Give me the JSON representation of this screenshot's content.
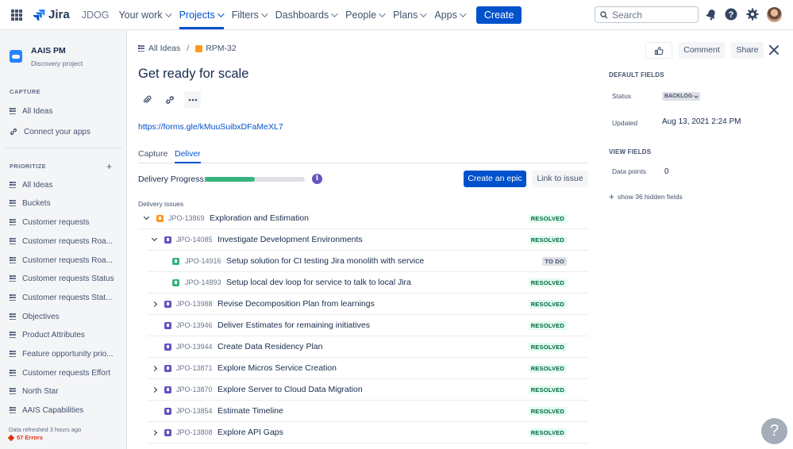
{
  "topnav": {
    "logo": "Jira",
    "instance": "JDOG",
    "items": [
      {
        "label": "Your work"
      },
      {
        "label": "Projects"
      },
      {
        "label": "Filters"
      },
      {
        "label": "Dashboards"
      },
      {
        "label": "People"
      },
      {
        "label": "Plans"
      },
      {
        "label": "Apps"
      }
    ],
    "create_label": "Create",
    "search_placeholder": "Search",
    "accent": "#0052cc"
  },
  "sidebar": {
    "project_name": "AAIS PM",
    "project_type": "Discovery project",
    "capture_label": "CAPTURE",
    "capture_items": [
      {
        "label": "All Ideas",
        "icon": "list-icon"
      },
      {
        "label": "Connect your apps",
        "icon": "link-icon"
      }
    ],
    "prioritize_label": "PRIORITIZE",
    "prioritize_items": [
      {
        "label": "All Ideas"
      },
      {
        "label": "Buckets"
      },
      {
        "label": "Customer requests"
      },
      {
        "label": "Customer requests Roa..."
      },
      {
        "label": "Customer requests Roa..."
      },
      {
        "label": "Customer requests Status"
      },
      {
        "label": "Customer requests Stat..."
      },
      {
        "label": "Objectives"
      },
      {
        "label": "Product Attributes"
      },
      {
        "label": "Feature opportunity prio..."
      },
      {
        "label": "Customer requests Effort"
      },
      {
        "label": "North Star"
      },
      {
        "label": "AAIS Capabilities"
      }
    ],
    "footer_refreshed": "Data refreshed 3 hours ago",
    "footer_errors": "57 Errors"
  },
  "issue": {
    "breadcrumb_root": "All Ideas",
    "breadcrumb_key": "RPM-32",
    "title": "Get ready for scale",
    "link": "https://forms.gle/kMuuSuibxDFaMeXL7",
    "tabs": [
      {
        "label": "Capture"
      },
      {
        "label": "Deliver"
      }
    ],
    "delivery_progress_label": "Delivery Progress:",
    "delivery_progress": 0.5,
    "create_epic_label": "Create an epic",
    "link_issue_label": "Link to issue",
    "delivery_issues_label": "Delivery issues",
    "rows": [
      {
        "level": 0,
        "caret": "down",
        "type": "idea",
        "key": "JPO-13869",
        "summary": "Exploration and Estimation",
        "status": "RESOLVED"
      },
      {
        "level": 1,
        "caret": "down",
        "type": "epic",
        "key": "JPO-14085",
        "summary": "Investigate Development Environments",
        "status": "RESOLVED"
      },
      {
        "level": 2,
        "caret": "",
        "type": "story",
        "key": "JPO-14916",
        "summary": "Setup solution for CI testing Jira monolith with service",
        "status": "TO DO"
      },
      {
        "level": 2,
        "caret": "",
        "type": "story",
        "key": "JPO-14893",
        "summary": "Setup local dev loop for service to talk to local Jira",
        "status": "RESOLVED"
      },
      {
        "level": 1,
        "caret": "right",
        "type": "epic",
        "key": "JPO-13988",
        "summary": "Revise Decomposition Plan from learnings",
        "status": "RESOLVED"
      },
      {
        "level": 1,
        "caret": "",
        "type": "epic",
        "key": "JPO-13946",
        "summary": "Deliver Estimates for remaining initiatives",
        "status": "RESOLVED"
      },
      {
        "level": 1,
        "caret": "",
        "type": "epic",
        "key": "JPO-13944",
        "summary": "Create Data Residency Plan",
        "status": "RESOLVED"
      },
      {
        "level": 1,
        "caret": "right",
        "type": "epic",
        "key": "JPO-13871",
        "summary": "Explore Micros Service Creation",
        "status": "RESOLVED"
      },
      {
        "level": 1,
        "caret": "right",
        "type": "epic",
        "key": "JPO-13870",
        "summary": "Explore Server to Cloud Data Migration",
        "status": "RESOLVED"
      },
      {
        "level": 1,
        "caret": "",
        "type": "epic",
        "key": "JPO-13854",
        "summary": "Estimate Timeline",
        "status": "RESOLVED"
      },
      {
        "level": 1,
        "caret": "right",
        "type": "epic",
        "key": "JPO-13808",
        "summary": "Explore API Gaps",
        "status": "RESOLVED"
      }
    ]
  },
  "panel": {
    "comment_label": "Comment",
    "share_label": "Share",
    "default_fields_label": "DEFAULT FIELDS",
    "status_label": "Status",
    "status_value": "BACKLOG",
    "updated_label": "Updated",
    "updated_value": "Aug 13, 2021 2:24 PM",
    "view_fields_label": "VIEW FIELDS",
    "data_points_label": "Data points",
    "data_points_value": "0",
    "hidden_fields_label": "show 36 hidden fields"
  },
  "help_label": "?"
}
